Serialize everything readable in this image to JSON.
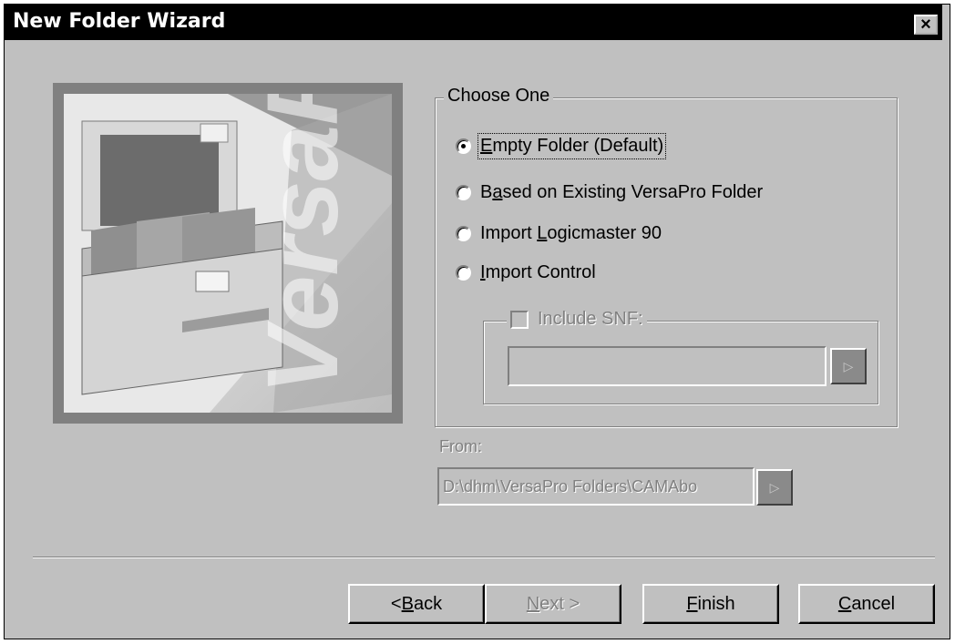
{
  "window": {
    "title": "New Folder Wizard",
    "close_glyph": "×"
  },
  "art": {
    "brand_text": "VersaPro"
  },
  "choose_group": {
    "legend": "Choose One",
    "options": [
      {
        "label_pre": "",
        "accel": "E",
        "label_post": "mpty Folder (Default)",
        "checked": true
      },
      {
        "label_pre": "B",
        "accel": "a",
        "label_post": "sed on Existing VersaPro Folder",
        "checked": false
      },
      {
        "label_pre": "Import ",
        "accel": "L",
        "label_post": "ogicmaster 90",
        "checked": false
      },
      {
        "label_pre": "",
        "accel": "I",
        "label_post": "mport Control",
        "checked": false
      }
    ]
  },
  "snf_group": {
    "checkbox_label": "Include SNF:",
    "field_value": "",
    "browse_glyph": "▷"
  },
  "from": {
    "label": "From:",
    "value": "D:\\dhm\\VersaPro Folders\\CAMAbo",
    "browse_glyph": "▷"
  },
  "buttons": {
    "back": {
      "pre": "< ",
      "accel": "B",
      "post": "ack"
    },
    "next": {
      "accel": "N",
      "post": "ext >"
    },
    "finish": {
      "accel": "F",
      "post": "inish"
    },
    "cancel": {
      "accel": "C",
      "post": "ancel"
    }
  },
  "colors": {
    "face": "#c0c0c0",
    "shadow": "#808080",
    "highlight": "#ffffff",
    "title_bg": "#000000"
  }
}
